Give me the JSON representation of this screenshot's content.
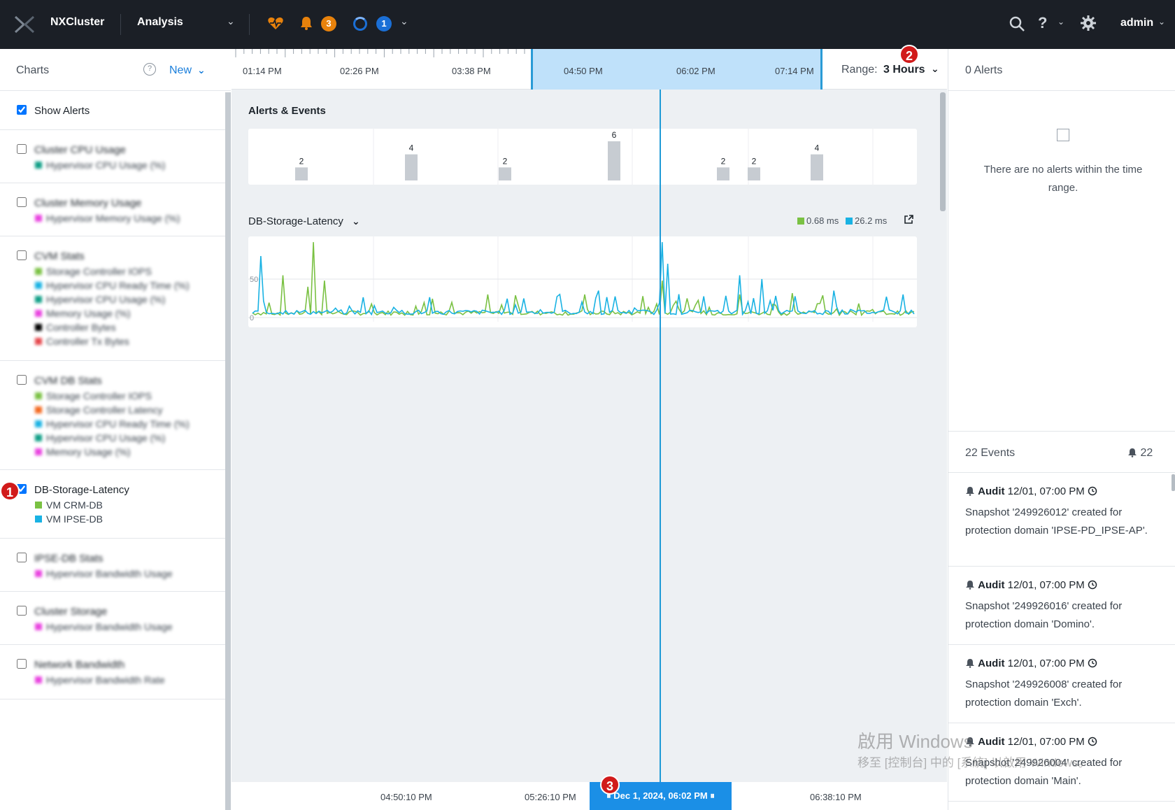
{
  "topbar": {
    "cluster_name": "NXCluster",
    "section": "Analysis",
    "alerts_count": "3",
    "tasks_count": "1",
    "user": "admin",
    "help_label": "?"
  },
  "left": {
    "header_title": "Charts",
    "help_label": "?",
    "new_label": "New",
    "show_alerts_label": "Show Alerts",
    "charts": [
      {
        "name": "Cluster CPU Usage",
        "checked": false,
        "series": [
          {
            "label": "Hypervisor CPU Usage (%)",
            "color": "#0f9e86"
          }
        ]
      },
      {
        "name": "Cluster Memory Usage",
        "checked": false,
        "series": [
          {
            "label": "Hypervisor Memory Usage (%)",
            "color": "#e944e0"
          }
        ]
      },
      {
        "name": "CVM Stats",
        "checked": false,
        "series": [
          {
            "label": "Storage Controller IOPS",
            "color": "#7ac143"
          },
          {
            "label": "Hypervisor CPU Ready Time (%)",
            "color": "#19b2e3"
          },
          {
            "label": "Hypervisor CPU Usage (%)",
            "color": "#0f9e86"
          },
          {
            "label": "Memory Usage (%)",
            "color": "#e944e0"
          },
          {
            "label": "Controller Bytes",
            "color": "#000000"
          },
          {
            "label": "Controller Tx Bytes",
            "color": "#e5484d"
          }
        ]
      },
      {
        "name": "CVM DB Stats",
        "checked": false,
        "series": [
          {
            "label": "Storage Controller IOPS",
            "color": "#7ac143"
          },
          {
            "label": "Storage Controller Latency",
            "color": "#f36a21"
          },
          {
            "label": "Hypervisor CPU Ready Time (%)",
            "color": "#19b2e3"
          },
          {
            "label": "Hypervisor CPU Usage (%)",
            "color": "#0f9e86"
          },
          {
            "label": "Memory Usage (%)",
            "color": "#e944e0"
          }
        ]
      },
      {
        "name": "DB-Storage-Latency",
        "checked": true,
        "series": [
          {
            "label": "VM CRM-DB",
            "color": "#7ac143"
          },
          {
            "label": "VM IPSE-DB",
            "color": "#19b2e3"
          }
        ]
      },
      {
        "name": "IPSE-DB Stats",
        "checked": false,
        "series": [
          {
            "label": "Hypervisor Bandwidth Usage",
            "color": "#e944e0"
          }
        ]
      },
      {
        "name": "Cluster Storage",
        "checked": false,
        "series": [
          {
            "label": "Hypervisor Bandwidth Usage",
            "color": "#e944e0"
          }
        ]
      },
      {
        "name": "Network Bandwidth",
        "checked": false,
        "series": [
          {
            "label": "Hypervisor Bandwidth Rate",
            "color": "#e944e0"
          }
        ]
      }
    ]
  },
  "center": {
    "time_labels": [
      "01:14 PM",
      "02:26 PM",
      "03:38 PM",
      "04:50 PM",
      "06:02 PM",
      "07:14 PM"
    ],
    "range_label": "Range:",
    "range_value": "3 Hours",
    "events_title": "Alerts & Events",
    "latency_title": "DB-Storage-Latency",
    "legend": [
      {
        "label": "0.68 ms",
        "color": "#7ac143"
      },
      {
        "label": "26.2 ms",
        "color": "#19b2e3"
      }
    ],
    "bottom_times": [
      "04:50:10 PM",
      "05:26:10 PM",
      "06:38:10 PM"
    ],
    "cursor_time": "Dec 1, 2024, 06:02 PM"
  },
  "chart_data": [
    {
      "type": "bar",
      "title": "Alerts & Events",
      "values": [
        2,
        4,
        2,
        6,
        2,
        2,
        4
      ]
    },
    {
      "type": "line",
      "title": "DB-Storage-Latency",
      "ylabel": "",
      "yticks": [
        "0",
        "50"
      ],
      "ylim": [
        0,
        100
      ],
      "series": [
        {
          "name": "VM CRM-DB",
          "color": "#7ac143"
        },
        {
          "name": "VM IPSE-DB",
          "color": "#19b2e3"
        }
      ]
    }
  ],
  "annotations": [
    "1",
    "2",
    "3"
  ],
  "right": {
    "alerts_header": "0 Alerts",
    "no_alerts_text": "There are no alerts within the time range.",
    "events_header": "22 Events",
    "events_count": "22",
    "events": [
      {
        "type": "Audit",
        "time": "12/01, 07:00 PM",
        "text": "Snapshot '249926012' created for protection domain 'IPSE-PD_IPSE-AP'."
      },
      {
        "type": "Audit",
        "time": "12/01, 07:00 PM",
        "text": "Snapshot '249926016' created for protection domain 'Domino'."
      },
      {
        "type": "Audit",
        "time": "12/01, 07:00 PM",
        "text": "Snapshot '249926008' created for protection domain 'Exch'."
      },
      {
        "type": "Audit",
        "time": "12/01, 07:00 PM",
        "text": "Snapshot '249926004' created for protection domain 'Main'."
      }
    ]
  },
  "watermark": {
    "line1": "啟用 Windows",
    "line2": "移至 [控制台] 中的 [系統] 以啟用 Windows。"
  }
}
